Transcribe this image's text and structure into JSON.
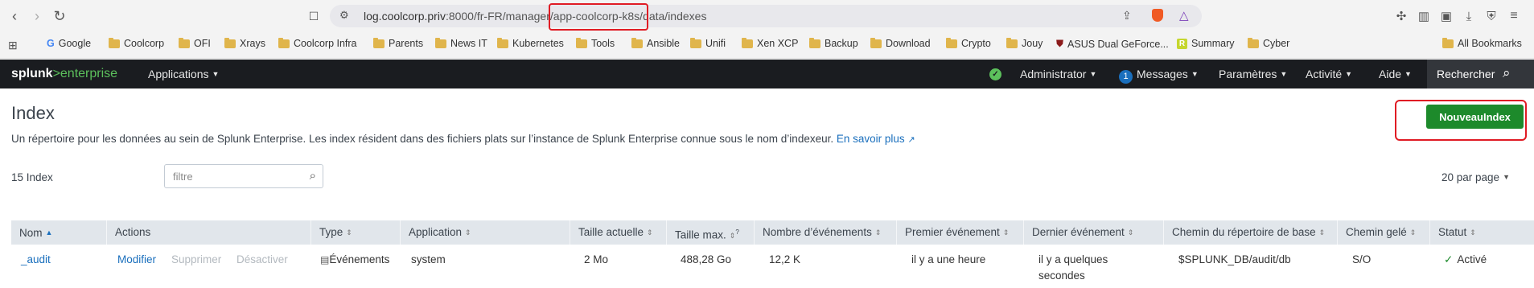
{
  "browser": {
    "url_host": "log.coolcorp.priv",
    "url_path_before": ":8000/fr-FR/manager",
    "url_path_highlight": "/app-coolcorp-k8s/",
    "url_path_after": "data/indexes",
    "bookmarks": [
      "Google",
      "Coolcorp",
      "OFI",
      "Xrays",
      "Coolcorp Infra",
      "Parents",
      "News IT",
      "Kubernetes",
      "Tools",
      "Ansible",
      "Unifi",
      "Xen XCP",
      "Backup",
      "Download",
      "Crypto",
      "Jouy",
      "ASUS Dual GeForce...",
      "Summary",
      "Cyber"
    ],
    "all_bookmarks": "All Bookmarks"
  },
  "splunk": {
    "logo_brand": "splunk",
    "logo_sep": ">",
    "logo_product": "enterprise",
    "menu_apps": "Applications",
    "menu_admin": "Administrator",
    "messages_count": "1",
    "menu_messages": "Messages",
    "menu_settings": "Paramètres",
    "menu_activity": "Activité",
    "menu_help": "Aide",
    "search_label": "Rechercher"
  },
  "page": {
    "title": "Index",
    "description": "Un répertoire pour les données au sein de Splunk Enterprise. Les index résident dans des fichiers plats sur l’instance de Splunk Enterprise connue sous le nom d’indexeur.",
    "learn_more": "En savoir plus",
    "new_button": "NouveauIndex",
    "count_label": "15 Index",
    "filter_placeholder": "filtre",
    "per_page": "20 par page"
  },
  "table": {
    "columns": [
      "Nom",
      "Actions",
      "Type",
      "Application",
      "Taille actuelle",
      "Taille max.",
      "Nombre d’événements",
      "Premier événement",
      "Dernier événement",
      "Chemin du répertoire de base",
      "Chemin gelé",
      "Statut"
    ],
    "rows": [
      {
        "name": "_audit",
        "action_edit": "Modifier",
        "action_delete": "Supprimer",
        "action_disable": "Désactiver",
        "type": "Événements",
        "application": "system",
        "current_size": "2 Mo",
        "max_size": "488,28 Go",
        "event_count": "12,2 K",
        "first_event": "il y a une heure",
        "last_event_1": "il y a quelques",
        "last_event_2": "secondes",
        "home_path": "$SPLUNK_DB/audit/db",
        "frozen_path": "S/O",
        "status": "Activé"
      }
    ]
  },
  "colors": {
    "splunk_green": "#5cc05c",
    "button_green": "#1d8a2b",
    "link_blue": "#1a6fbd",
    "highlight_red": "#e01b24"
  }
}
